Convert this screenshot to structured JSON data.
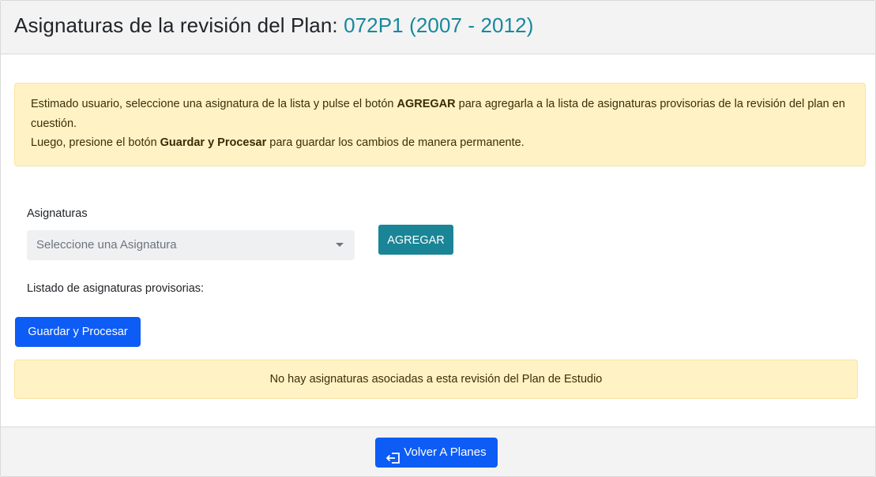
{
  "header": {
    "title": "Asignaturas de la revisión del Plan:",
    "plan_code": "072P1 (2007 - 2012)"
  },
  "info_alert": {
    "line1_pre": "Estimado usuario, seleccione una asignatura de la lista y pulse el botón ",
    "line1_bold": "AGREGAR",
    "line1_post": " para agregarla a la lista de asignaturas provisorias de la revisión del plan en cuestión.",
    "line2_pre": "Luego, presione el botón ",
    "line2_bold": "Guardar y Procesar",
    "line2_post": " para guardar los cambios de manera permanente."
  },
  "form": {
    "label": "Asignaturas",
    "select_placeholder": "Seleccione una Asignatura",
    "add_button": "AGREGAR"
  },
  "list": {
    "label": "Listado de asignaturas provisorias:",
    "save_button": "Guardar y Procesar",
    "empty_message": "No hay asignaturas asociadas a esta revisión del Plan de Estudio"
  },
  "footer": {
    "back_button": "Volver A Planes",
    "back_icon": "sign-out-icon"
  },
  "colors": {
    "accent_teal": "#17889e",
    "primary_blue": "#0d5cf5",
    "warning_bg": "#fff2c5"
  }
}
